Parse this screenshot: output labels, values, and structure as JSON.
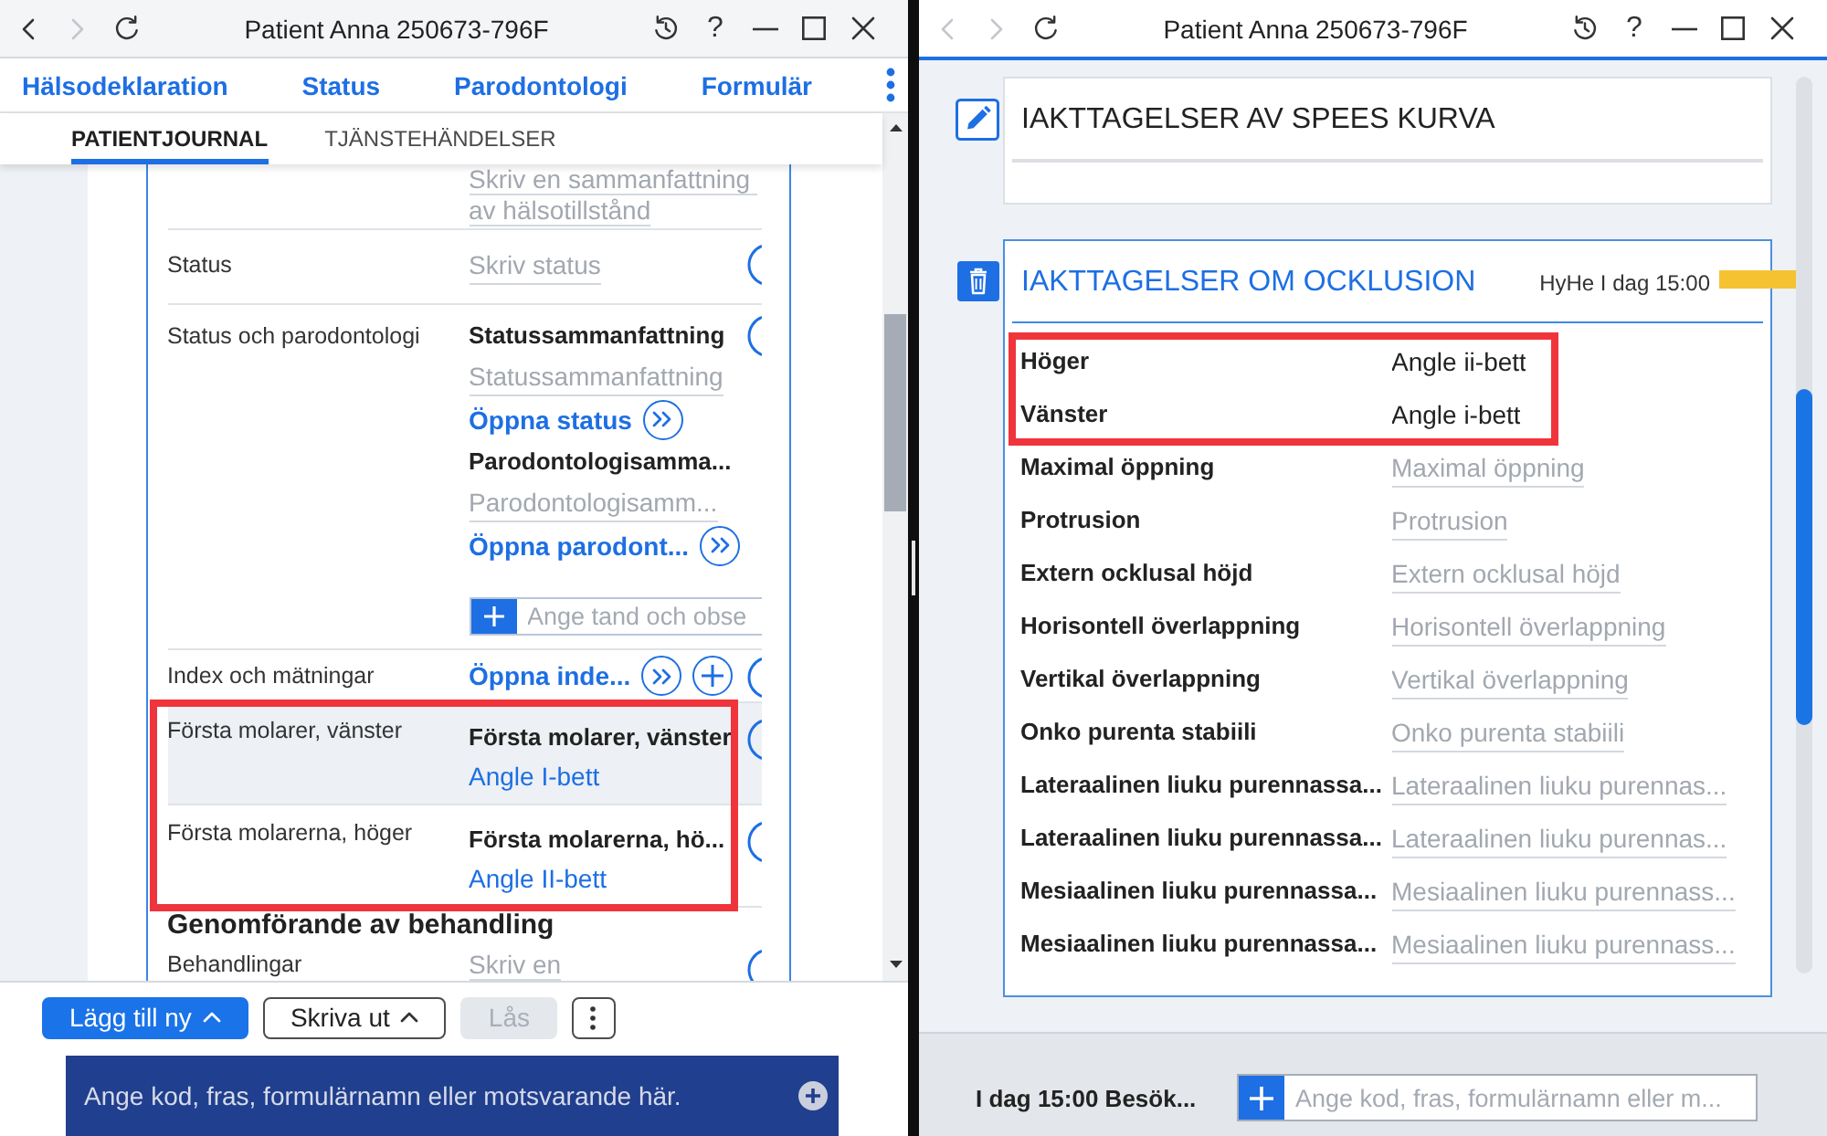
{
  "left_window": {
    "title_bar": {
      "title": "Patient Anna 250673-796F",
      "help": "?",
      "active": false,
      "back_disabled": false,
      "forward_disabled": true
    },
    "nav_links": [
      {
        "label": "Hälsodeklaration"
      },
      {
        "label": "Status"
      },
      {
        "label": "Parodontologi"
      },
      {
        "label": "Formulär"
      }
    ],
    "tabs": [
      {
        "label": "PATIENTJOURNAL",
        "selected": true
      },
      {
        "label": "TJÄNSTEHÄNDELSER",
        "selected": false
      }
    ],
    "journal": {
      "rows": [
        {
          "kind": "note",
          "placeholder": "Skriv en sammanfattning av hälsotillstånd",
          "selected": false,
          "highlighted": false
        },
        {
          "kind": "field",
          "label": "Status",
          "placeholder": "Skriv status",
          "selected": false,
          "highlighted": false
        },
        {
          "kind": "summary",
          "label": "Status och parodontologi",
          "sections": [
            {
              "heading": "Statussammanfattning",
              "placeholder": "Statussammanfattning",
              "link": "Öppna status"
            },
            {
              "heading": "Parodontologisamma...",
              "placeholder": "Parodontologisamm...",
              "link": "Öppna parodont..."
            }
          ],
          "tooth_field": {
            "placeholder": "Ange tand och obse"
          },
          "selected": false,
          "highlighted": false
        },
        {
          "kind": "links",
          "label": "Index och mätningar",
          "link": "Öppna inde...",
          "selected": false,
          "highlighted": false
        },
        {
          "kind": "result",
          "label": "Första molarer, vänster",
          "heading": "Första molarer, vänster",
          "link": "Angle I-bett",
          "selected": true,
          "highlighted": true
        },
        {
          "kind": "result",
          "label": "Första molarerna, höger",
          "heading": "Första molarerna, hö...",
          "link": "Angle II-bett",
          "selected": false,
          "highlighted": true
        }
      ],
      "section": {
        "title": "Genomförande av behandling",
        "rows": [
          {
            "kind": "field",
            "label": "Behandlingar",
            "placeholder": "Skriv en",
            "selected": false,
            "highlighted": false
          }
        ]
      }
    },
    "toolbar": [
      {
        "kind": "primary",
        "label": "Lägg till ny",
        "menu": true,
        "disabled": false
      },
      {
        "kind": "outline",
        "label": "Skriva ut",
        "menu": true,
        "disabled": false
      },
      {
        "kind": "primary",
        "label": "Lås",
        "menu": false,
        "disabled": true
      },
      {
        "kind": "more",
        "menu": false,
        "disabled": false
      }
    ],
    "command_field": {
      "placeholder": "Ange kod, fras, formulärnamn eller motsvarande här."
    }
  },
  "right_window": {
    "title_bar": {
      "title": "Patient Anna 250673-796F",
      "help": "?",
      "active": true,
      "back_disabled": true,
      "forward_disabled": true
    },
    "cards": [
      {
        "kind": "edit",
        "title": "IAKTTAGELSER AV SPEES KURVA",
        "active": false
      },
      {
        "kind": "delete",
        "title": "IAKTTAGELSER OM OCKLUSION",
        "active": true,
        "meta": "HyHe I dag 15:00",
        "color": "#f5c232",
        "rows": [
          {
            "label": "Höger",
            "value": "Angle ii-bett",
            "highlighted": true
          },
          {
            "label": "Vänster",
            "value": "Angle i-bett",
            "highlighted": true
          },
          {
            "label": "Maximal öppning",
            "placeholder": "Maximal öppning",
            "highlighted": false
          },
          {
            "label": "Protrusion",
            "placeholder": "Protrusion",
            "highlighted": false
          },
          {
            "label": "Extern ocklusal höjd",
            "placeholder": "Extern ocklusal höjd",
            "highlighted": false
          },
          {
            "label": "Horisontell överlappning",
            "placeholder": "Horisontell överlappning",
            "highlighted": false
          },
          {
            "label": "Vertikal överlappning",
            "placeholder": "Vertikal överlappning",
            "highlighted": false
          },
          {
            "label": "Onko purenta stabiili",
            "placeholder": "Onko purenta stabiili",
            "highlighted": false
          },
          {
            "label": "Lateraalinen liuku purennassa...",
            "placeholder": "Lateraalinen liuku purennas...",
            "highlighted": false
          },
          {
            "label": "Lateraalinen liuku purennassa...",
            "placeholder": "Lateraalinen liuku purennas...",
            "highlighted": false
          },
          {
            "label": "Mesiaalinen liuku purennassa...",
            "placeholder": "Mesiaalinen liuku purennass...",
            "highlighted": false
          },
          {
            "label": "Mesiaalinen liuku purennassa...",
            "placeholder": "Mesiaalinen liuku purennass...",
            "highlighted": false
          }
        ]
      }
    ],
    "footer": {
      "visit": "I dag 15:00 Besök...",
      "command_field": {
        "placeholder": "Ange kod, fras, formulärnamn eller m..."
      }
    }
  }
}
